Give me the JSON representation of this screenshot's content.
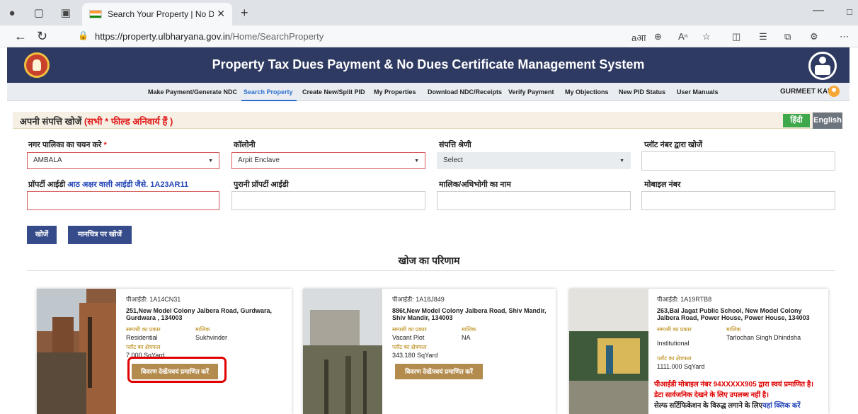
{
  "browser": {
    "tab_title": "Search Your Property | No Dues C",
    "url_host": "https://property.ulbharyana.gov.in",
    "url_path": "/Home/SearchProperty"
  },
  "header": {
    "title": "Property Tax Dues Payment & No Dues Certificate Management System"
  },
  "nav": {
    "items": [
      "Make Payment/Generate NDC",
      "Search Property",
      "Create New/Split PID",
      "My Properties",
      "Download NDC/Receipts",
      "Verify Payment",
      "My Objections",
      "New PID Status",
      "User Manuals"
    ],
    "active": "Search Property",
    "user": "GURMEET KAUR"
  },
  "panel": {
    "title": "अपनी संपत्ति खोजें",
    "required_note": "(सभी * फील्ड अनिवार्य हैं )",
    "lang_hindi": "हिंदी",
    "lang_english": "English"
  },
  "form": {
    "municipality_label": "नगर पालिका का चयन करे",
    "municipality_value": "AMBALA",
    "colony_label": "कॉलोनी",
    "colony_value": "Arpit Enclave",
    "category_label": "संपत्ति श्रेणी",
    "category_value": "Select",
    "plot_label": "प्लॉट नंबर द्वारा खोजें",
    "pid_label": "प्रॉपर्टी आईडी",
    "pid_hint": "आठ अक्षर वाली आईडी जैसे. 1A23AR11",
    "old_pid_label": "पुरानी प्रॉपर्टी आईडी",
    "owner_label": "मालिक/अधिभोगी का नाम",
    "mobile_label": "मोबाइल नंबर",
    "search_button": "खोजें",
    "map_search_button": "मानचित्र पर खोजें"
  },
  "results": {
    "title": "खोज का परिणाम",
    "cards": [
      {
        "pid": "पीआईडी: 1A14CN31",
        "address": "251,New Model Colony Jalbera Road, Gurdwara, Gurdwara , 134003",
        "type_label": "सम्पत्ती का प्रकार",
        "type": "Residential",
        "owner_label": "मालिक",
        "owner": "Sukhvinder",
        "area_label": "प्लॉट का क्षेत्रफल",
        "area": "7.000 SqYard",
        "button": "विवरण देखें/स्वयं प्रमाणित करें"
      },
      {
        "pid": "पीआईडी: 1A18J849",
        "address": "886t,New Model Colony Jalbera Road, Shiv Mandir, Shiv Mandir, 134003",
        "type_label": "सम्पत्ती का प्रकार",
        "type": "Vacant Plot",
        "owner_label": "मालिक",
        "owner": "NA",
        "area_label": "प्लॉट का क्षेत्रफल",
        "area": "343.180 SqYard",
        "button": "विवरण देखें/स्वयं प्रमाणित करें"
      },
      {
        "pid": "पीआईडी: 1A19RTB8",
        "address": "263,Bal Jagat Public School, New Model Colony Jalbera Road, Power House, Power House, 134003",
        "type_label": "सम्पत्ती का प्रकार",
        "type": "Institutional",
        "owner_label": "मालिक",
        "owner": "Tarlochan Singh Dhindsha",
        "area_label": "प्लॉट का क्षेत्रफल",
        "area": "1111.000 SqYard",
        "note_red_1": "पीआईडी मोबाइल नंबर 94XXXXX905 द्वारा स्वयं प्रमाणित है।",
        "note_red_2": "डेटा सार्वजनिक देखने के लिए उपलब्ध नहीं है।",
        "note_black": "सेल्फ सर्टिफिकेशन के विरुद्ध लगाने के लिए",
        "note_link": "यहां क्लिक करें"
      }
    ]
  }
}
